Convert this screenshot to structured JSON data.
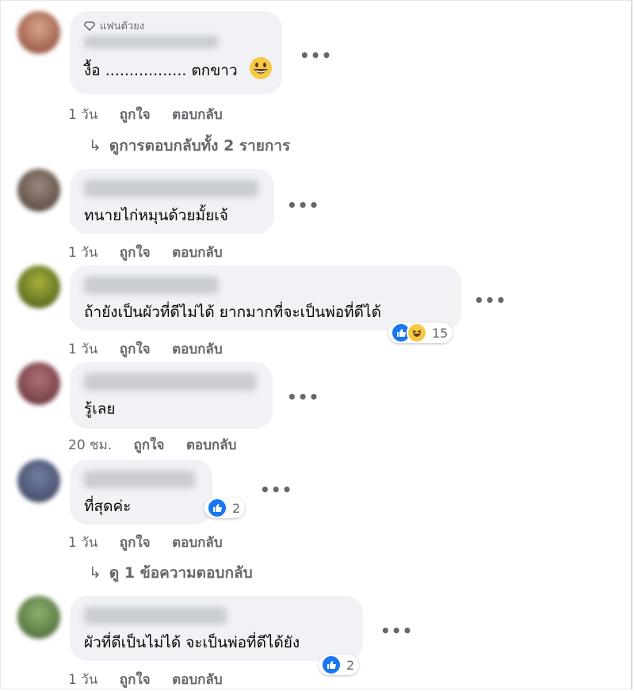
{
  "comments": [
    {
      "badge": "แฟนตัวยง",
      "text": "งื้อ ................. ตกขาว",
      "emoji": "grinning-face-emoji",
      "time": "1 วัน",
      "like": "ถูกใจ",
      "reply": "ตอบกลับ",
      "replies_link": "ดูการตอบกลับทั้ง 2 รายการ"
    },
    {
      "text": "ทนายไก่หมุนด้วยมั้ยเจ้",
      "time": "1 วัน",
      "like": "ถูกใจ",
      "reply": "ตอบกลับ"
    },
    {
      "text": "ถ้ายังเป็นผัวที่ดีไม่ได้ ยากมากที่จะเป็นพ่อที่ดีได้",
      "reaction_count": "15",
      "time": "1 วัน",
      "like": "ถูกใจ",
      "reply": "ตอบกลับ"
    },
    {
      "text": "รู้เลย",
      "time": "20 ชม.",
      "like": "ถูกใจ",
      "reply": "ตอบกลับ"
    },
    {
      "text": "ที่สุดค่ะ",
      "reaction_count": "2",
      "time": "1 วัน",
      "like": "ถูกใจ",
      "reply": "ตอบกลับ",
      "replies_link": "ดู 1 ข้อความตอบกลับ"
    },
    {
      "text": "ผัวที่ดีเป็นไม่ได้ จะเป็นพ่อที่ดีได้ยัง",
      "reaction_count": "2",
      "time": "1 วัน",
      "like": "ถูกใจ",
      "reply": "ตอบกลับ"
    }
  ],
  "ui": {
    "more_label": "•••",
    "reply_arrow": "↳"
  },
  "colors": {
    "bubble": "#f0f2f5",
    "meta": "#65676b",
    "like_blue": "#1877f2",
    "haha_yellow": "#f7c843"
  }
}
